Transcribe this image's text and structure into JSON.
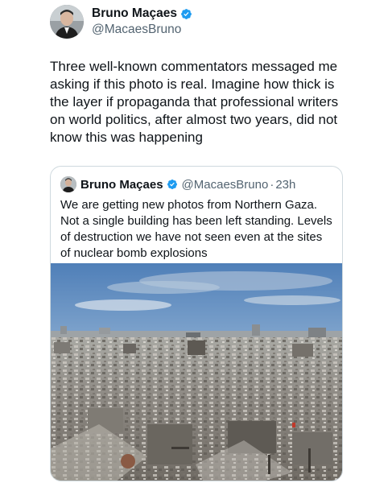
{
  "tweet": {
    "author_name": "Bruno Maçaes",
    "author_handle": "@MacaesBruno",
    "text": "Three well-known commentators messaged me asking if this photo is real. Imagine how thick is the layer if propaganda that professional writers on world politics, after almost two years, did not know this was happening"
  },
  "quoted_tweet": {
    "author_name": "Bruno Maçaes",
    "author_handle": "@MacaesBruno",
    "separator": "·",
    "time": "23h",
    "text": "We are getting new photos from Northern Gaza. Not a single building has been left standing. Levels of destruction we have not seen even at the sites of nuclear bomb explosions"
  },
  "icons": {
    "verified": "verified-badge-icon"
  },
  "colors": {
    "verified_blue": "#1d9bf0",
    "text_primary": "#0f1419",
    "text_secondary": "#536471",
    "border": "#cfd9de"
  }
}
